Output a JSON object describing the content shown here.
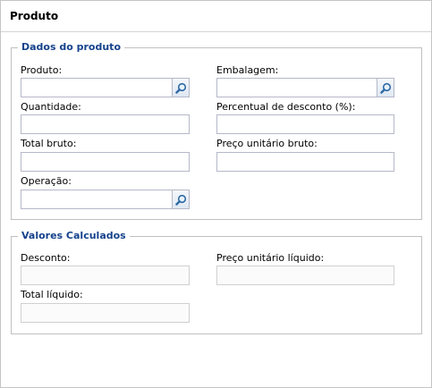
{
  "panel": {
    "title": "Produto"
  },
  "dados": {
    "legend": "Dados do produto",
    "produto": {
      "label": "Produto:",
      "value": ""
    },
    "embalagem": {
      "label": "Embalagem:",
      "value": ""
    },
    "quantidade": {
      "label": "Quantidade:",
      "value": ""
    },
    "percentual": {
      "label": "Percentual de desconto (%):",
      "value": ""
    },
    "total_bruto": {
      "label": "Total bruto:",
      "value": ""
    },
    "preco_bruto": {
      "label": "Preço unitário bruto:",
      "value": ""
    },
    "operacao": {
      "label": "Operação:",
      "value": ""
    }
  },
  "valores": {
    "legend": "Valores Calculados",
    "desconto": {
      "label": "Desconto:",
      "value": ""
    },
    "preco_liquido": {
      "label": "Preço unitário líquido:",
      "value": ""
    },
    "total_liquido": {
      "label": "Total líquido:",
      "value": ""
    }
  },
  "icons": {
    "lookup": "magnifier-icon"
  },
  "colors": {
    "legend": "#15428b",
    "border": "#c0c0c0",
    "input_border": "#b5b8c8"
  }
}
